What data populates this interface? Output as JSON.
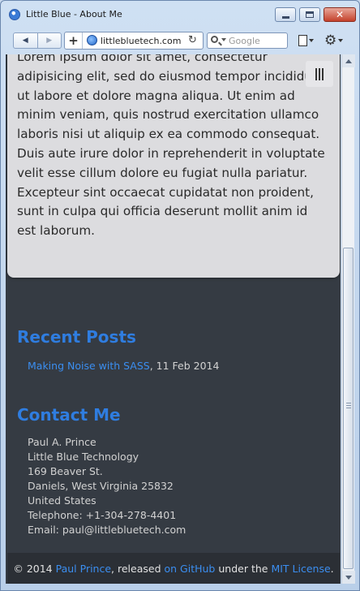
{
  "window": {
    "title": "Little Blue - About Me",
    "close_glyph": "✕"
  },
  "toolbar": {
    "back_glyph": "◀",
    "forward_glyph": "▶",
    "plus_glyph": "+",
    "url": "littlebluetech.com",
    "reload_glyph": "↻",
    "search_placeholder": "Google",
    "tools_glyph": "⚙"
  },
  "page": {
    "lorem": "Lorem ipsum dolor sit amet, consectetur adipisicing elit, sed do eiusmod tempor incididunt ut labore et dolore magna aliqua. Ut enim ad minim veniam, quis nostrud exercitation ullamco laboris nisi ut aliquip ex ea commodo consequat. Duis aute irure dolor in reprehenderit in voluptate velit esse cillum dolore eu fugiat nulla pariatur. Excepteur sint occaecat cupidatat non proident, sunt in culpa qui officia deserunt mollit anim id est laborum.",
    "recent_posts": {
      "heading": "Recent Posts",
      "items": [
        {
          "title": "Making Noise with SASS",
          "date": ", 11 Feb 2014"
        }
      ]
    },
    "contact": {
      "heading": "Contact Me",
      "lines": [
        "Paul A. Prince",
        "Little Blue Technology",
        "169 Beaver St.",
        "Daniels, West Virginia 25832",
        "United States",
        "Telephone: +1-304-278-4401",
        "Email: paul@littlebluetech.com"
      ]
    },
    "footer": {
      "prefix": "© 2014 ",
      "author": "Paul Prince",
      "mid": ", released ",
      "github": "on GitHub",
      "under": " under the ",
      "license": "MIT License",
      "end": "."
    }
  }
}
